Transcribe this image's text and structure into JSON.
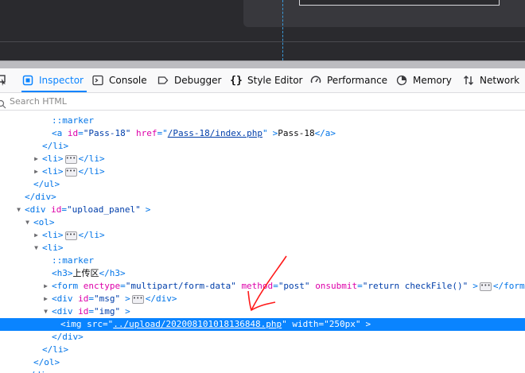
{
  "toolbar": {
    "tabs": [
      {
        "label": "Inspector",
        "icon": "inspector-icon",
        "active": true
      },
      {
        "label": "Console",
        "icon": "console-icon"
      },
      {
        "label": "Debugger",
        "icon": "debugger-icon"
      },
      {
        "label": "Style Editor",
        "icon": "style-editor-icon"
      },
      {
        "label": "Performance",
        "icon": "performance-icon"
      },
      {
        "label": "Memory",
        "icon": "memory-icon"
      },
      {
        "label": "Network",
        "icon": "network-icon"
      }
    ]
  },
  "search": {
    "placeholder": "Search HTML"
  },
  "tree": {
    "marker": "::marker",
    "a_tag": "a",
    "a_id_attr": "id",
    "a_id_val": "\"Pass-18\"",
    "a_href_attr": "href",
    "a_href_val": "/Pass-18/index.php",
    "a_text": "Pass-18",
    "div_id_val": "\"upload_panel\"",
    "h3_text": "上传区",
    "form_enctype": "\"multipart/form-data\"",
    "form_method": "\"post\"",
    "form_onsubmit": "\"return checkFile()\"",
    "msg_id": "\"msg\"",
    "img_div_id": "\"img\"",
    "img_src": "../upload/202008101018136848.php",
    "img_width": "\"250px\""
  },
  "colors": {
    "accent": "#0a84ff",
    "tag": "#0074e8",
    "attr_name": "#dd00a9",
    "attr_value": "#003eaa",
    "annotation": "#ff0000"
  }
}
